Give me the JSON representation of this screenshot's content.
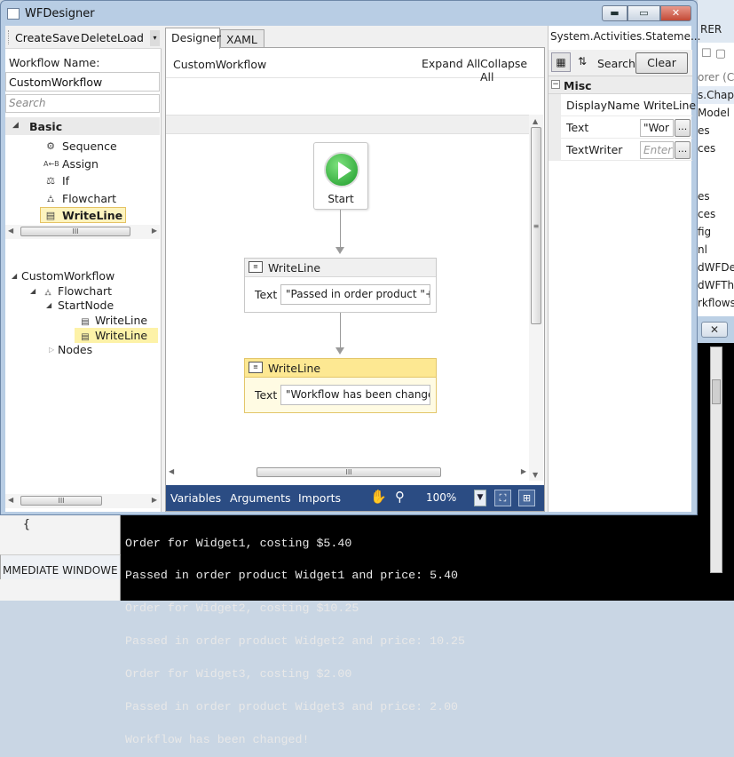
{
  "window": {
    "title": "WFDesigner",
    "min_label": "▬",
    "max_label": "▭",
    "close_label": "✕"
  },
  "toolbar": {
    "create": "Create",
    "save": "Save",
    "delete": "Delete",
    "load": "Load"
  },
  "workflow_name": {
    "label": "Workflow Name:",
    "value": "CustomWorkflow"
  },
  "search": {
    "placeholder": "Search"
  },
  "toolbox": {
    "category": "Basic",
    "items": [
      {
        "label": "Sequence",
        "icon": "sequence-icon",
        "glyph": "⚙"
      },
      {
        "label": "Assign",
        "icon": "assign-icon",
        "glyph": "A←B"
      },
      {
        "label": "If",
        "icon": "if-icon",
        "glyph": "⚖"
      },
      {
        "label": "Flowchart",
        "icon": "flowchart-icon",
        "glyph": "⛼"
      },
      {
        "label": "WriteLine",
        "icon": "writeline-icon",
        "glyph": "▤",
        "selected": true
      }
    ]
  },
  "outline": {
    "root": "CustomWorkflow",
    "flowchart": "Flowchart",
    "start_node": "StartNode",
    "writeline_1": "WriteLine",
    "writeline_2": "WriteLine",
    "nodes": "Nodes"
  },
  "tabs": {
    "designer": "Designer",
    "xaml": "XAML"
  },
  "designer": {
    "workflow_name": "CustomWorkflow",
    "expand_all": "Expand All",
    "collapse_all": "Collapse All",
    "start_label": "Start",
    "activity1": {
      "title": "WriteLine",
      "text_label": "Text",
      "text_value": "\"Passed in order product \"+ir"
    },
    "activity2": {
      "title": "WriteLine",
      "text_label": "Text",
      "text_value": "\"Workflow has been changec"
    },
    "status": {
      "variables": "Variables",
      "arguments": "Arguments",
      "imports": "Imports",
      "zoom": "100%"
    }
  },
  "properties": {
    "title": "System.Activities.Stateme...",
    "search_label": "Search:",
    "clear": "Clear",
    "category": "Misc",
    "rows": [
      {
        "name": "DisplayName",
        "value": "WriteLine"
      },
      {
        "name": "Text",
        "value": "\"Wor"
      },
      {
        "name": "TextWriter",
        "value": "Enter"
      }
    ],
    "ellipsis": "..."
  },
  "background_window": {
    "header": "RER",
    "items": [
      "orer (Ct",
      "s.Chapt",
      "Model",
      "es",
      "ces",
      "es",
      "ces",
      "fig",
      "nl",
      "dWFDes",
      "dWFThr",
      "rkflows",
      "es"
    ]
  },
  "bottom_panel": {
    "code": "{",
    "tab1": "MMEDIATE WINDOW",
    "tab2": "E"
  },
  "console_lines": [
    "Order for Widget1, costing $5.40",
    "Passed in order product Widget1 and price: 5.40",
    "Order for Widget2, costing $10.25",
    "Passed in order product Widget2 and price: 10.25",
    "Order for Widget3, costing $2.00",
    "Passed in order product Widget3 and price: 2.00",
    "Workflow has been changed!"
  ],
  "colors": {
    "accent": "#2b4c83",
    "selection": "#fdf4bf",
    "start_green": "#1c9a29",
    "window_frame": "#b8cde4"
  }
}
